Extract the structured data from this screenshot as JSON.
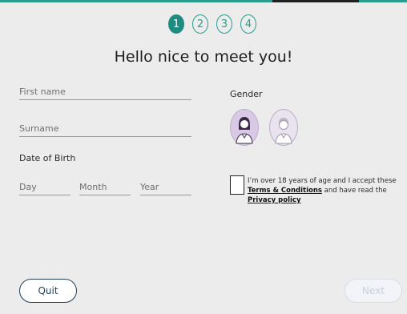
{
  "steps": [
    "1",
    "2",
    "3",
    "4"
  ],
  "title": "Hello nice to meet you!",
  "form": {
    "first_name_placeholder": "First name",
    "surname_placeholder": "Surname",
    "dob_label": "Date of Birth",
    "day_placeholder": "Day",
    "month_placeholder": "Month",
    "year_placeholder": "Year"
  },
  "gender": {
    "label": "Gender",
    "options": [
      "female",
      "male"
    ],
    "selected": "female"
  },
  "terms": {
    "prefix": "I’m over 18 years of age and I accept these ",
    "terms_link": "Terms & Conditions",
    "middle": " and have read the ",
    "privacy_link": "Privacy policy"
  },
  "buttons": {
    "quit": "Quit",
    "next": "Next"
  },
  "colors": {
    "accent": "#2a9d8f",
    "quit_border": "#1f3f5a",
    "next_disabled": "#c7d0dc"
  }
}
